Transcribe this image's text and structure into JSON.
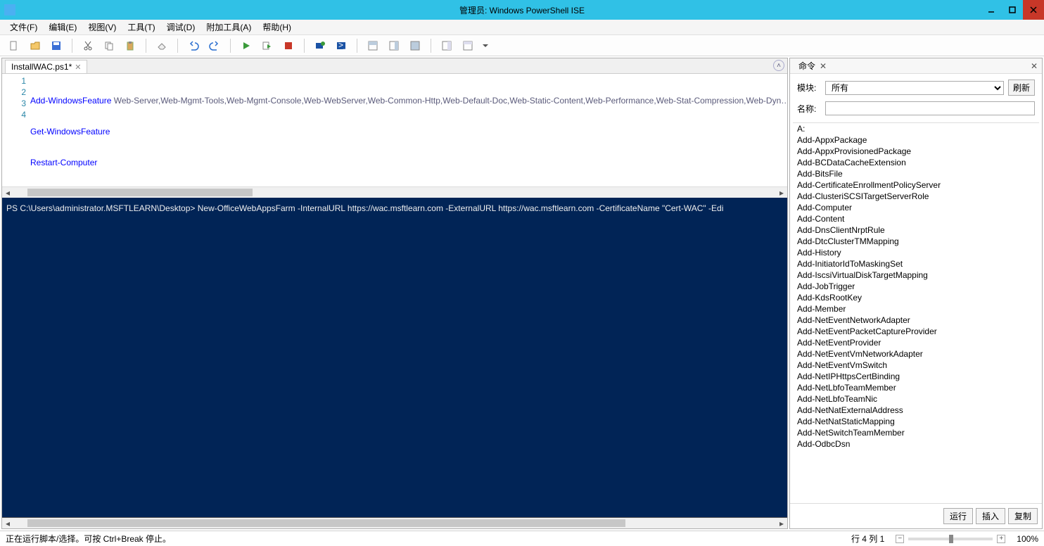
{
  "window": {
    "title": "管理员: Windows PowerShell ISE"
  },
  "menu": {
    "file": "文件(F)",
    "edit": "编辑(E)",
    "view": "视图(V)",
    "tools": "工具(T)",
    "debug": "调试(D)",
    "addons": "附加工具(A)",
    "help": "帮助(H)"
  },
  "tab": {
    "title": "InstallWAC.ps1*"
  },
  "code": {
    "line1_kw": "Add-WindowsFeature",
    "line1_args": " Web-Server,Web-Mgmt-Tools,Web-Mgmt-Console,Web-WebServer,Web-Common-Http,Web-Default-Doc,Web-Static-Content,Web-Performance,Web-Stat-Compression,Web-Dyn…",
    "line2_kw": "Get-WindowsFeature",
    "line3_kw": "Restart-Computer",
    "line4_kw": "New-OfficeWebAppsFarm",
    "line4_p1": " -InternalURL",
    "line4_u1": " https://wac.msftlearn.com",
    "line4_p2": " -ExternalURL",
    "line4_u2": " https://wac.msftlearn.com",
    "line4_p3": " -CertificateName",
    "line4_str": " \"Cert-WAC\"",
    "line4_p4": " -EditingEnabled"
  },
  "lineNumbers": [
    "1",
    "2",
    "3",
    "4"
  ],
  "console": {
    "blank1": "",
    "blank2": "",
    "prompt": "PS C:\\Users\\administrator.MSFTLEARN\\Desktop> New-OfficeWebAppsFarm -InternalURL https://wac.msftlearn.com -ExternalURL https://wac.msftlearn.com -CertificateName \"Cert-WAC\" -Edi"
  },
  "commandPane": {
    "header": "命令",
    "moduleLabel": "模块:",
    "moduleValue": "所有",
    "refresh": "刷新",
    "nameLabel": "名称:",
    "nameValue": "",
    "run": "运行",
    "insert": "插入",
    "copy": "复制",
    "list": [
      "A:",
      "Add-AppxPackage",
      "Add-AppxProvisionedPackage",
      "Add-BCDataCacheExtension",
      "Add-BitsFile",
      "Add-CertificateEnrollmentPolicyServer",
      "Add-ClusteriSCSITargetServerRole",
      "Add-Computer",
      "Add-Content",
      "Add-DnsClientNrptRule",
      "Add-DtcClusterTMMapping",
      "Add-History",
      "Add-InitiatorIdToMaskingSet",
      "Add-IscsiVirtualDiskTargetMapping",
      "Add-JobTrigger",
      "Add-KdsRootKey",
      "Add-Member",
      "Add-NetEventNetworkAdapter",
      "Add-NetEventPacketCaptureProvider",
      "Add-NetEventProvider",
      "Add-NetEventVmNetworkAdapter",
      "Add-NetEventVmSwitch",
      "Add-NetIPHttpsCertBinding",
      "Add-NetLbfoTeamMember",
      "Add-NetLbfoTeamNic",
      "Add-NetNatExternalAddress",
      "Add-NetNatStaticMapping",
      "Add-NetSwitchTeamMember",
      "Add-OdbcDsn"
    ]
  },
  "status": {
    "message": "正在运行脚本/选择。可按 Ctrl+Break 停止。",
    "cursor": "行 4 列 1",
    "zoom": "100%"
  }
}
